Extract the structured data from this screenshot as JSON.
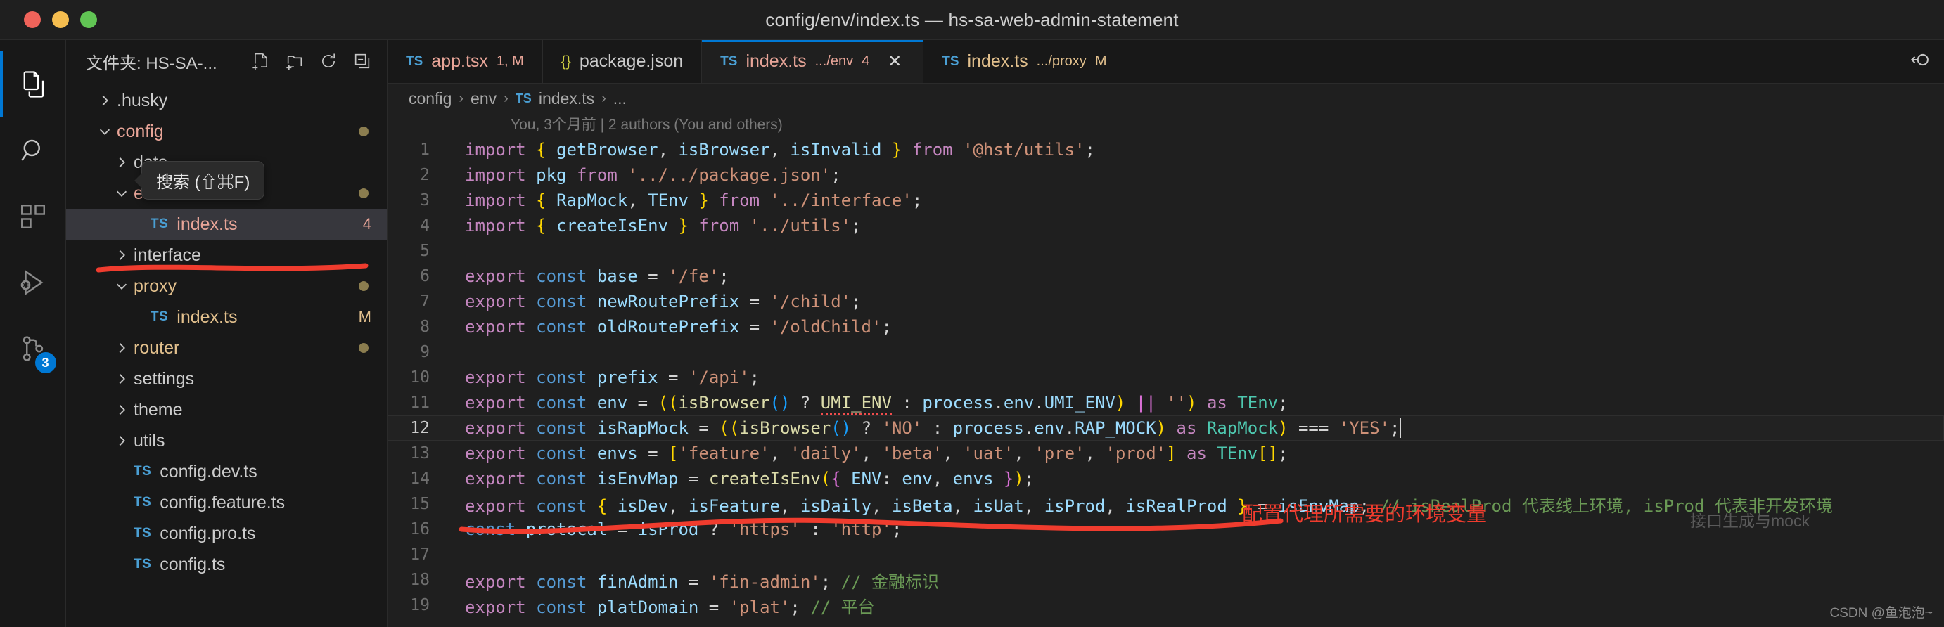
{
  "window": {
    "title": "config/env/index.ts — hs-sa-web-admin-statement",
    "traffic_lights": [
      "close",
      "minimize",
      "zoom"
    ]
  },
  "activitybar": {
    "items": [
      {
        "name": "explorer",
        "icon": "files-icon",
        "active": true,
        "badge": ""
      },
      {
        "name": "search",
        "icon": "search-icon",
        "active": false,
        "badge": ""
      },
      {
        "name": "extensions",
        "icon": "extensions-icon",
        "active": false,
        "badge": ""
      },
      {
        "name": "run-and-debug",
        "icon": "run-debug-icon",
        "active": false,
        "badge": ""
      },
      {
        "name": "source-control",
        "icon": "source-control-icon",
        "active": false,
        "badge": "3"
      }
    ]
  },
  "tooltip": {
    "text": "搜索 (⇧⌘F)"
  },
  "explorer": {
    "title": "文件夹: HS-SA-...",
    "actions": [
      "new-file-icon",
      "new-folder-icon",
      "refresh-icon",
      "collapse-all-icon"
    ],
    "tree": [
      {
        "label": ".husky",
        "kind": "folder",
        "expanded": false,
        "indent": 1,
        "color": "plain",
        "status": "",
        "dot": false,
        "selected": false
      },
      {
        "label": "config",
        "kind": "folder",
        "expanded": true,
        "indent": 1,
        "color": "mod",
        "status": "",
        "dot": true,
        "selected": false
      },
      {
        "label": "data",
        "kind": "folder",
        "expanded": false,
        "indent": 2,
        "color": "plain",
        "status": "",
        "dot": false,
        "selected": false
      },
      {
        "label": "env",
        "kind": "folder",
        "expanded": true,
        "indent": 2,
        "color": "mod",
        "status": "",
        "dot": true,
        "selected": false
      },
      {
        "label": "index.ts",
        "kind": "ts",
        "expanded": null,
        "indent": 3,
        "color": "mod",
        "status": "4",
        "dot": false,
        "selected": true
      },
      {
        "label": "interface",
        "kind": "folder",
        "expanded": false,
        "indent": 2,
        "color": "plain",
        "status": "",
        "dot": false,
        "selected": false
      },
      {
        "label": "proxy",
        "kind": "folder",
        "expanded": true,
        "indent": 2,
        "color": "yellow",
        "status": "",
        "dot": true,
        "selected": false
      },
      {
        "label": "index.ts",
        "kind": "ts",
        "expanded": null,
        "indent": 3,
        "color": "yellow",
        "status": "M",
        "dot": false,
        "selected": false
      },
      {
        "label": "router",
        "kind": "folder",
        "expanded": false,
        "indent": 2,
        "color": "yellow",
        "status": "",
        "dot": true,
        "selected": false
      },
      {
        "label": "settings",
        "kind": "folder",
        "expanded": false,
        "indent": 2,
        "color": "plain",
        "status": "",
        "dot": false,
        "selected": false
      },
      {
        "label": "theme",
        "kind": "folder",
        "expanded": false,
        "indent": 2,
        "color": "plain",
        "status": "",
        "dot": false,
        "selected": false
      },
      {
        "label": "utils",
        "kind": "folder",
        "expanded": false,
        "indent": 2,
        "color": "plain",
        "status": "",
        "dot": false,
        "selected": false
      },
      {
        "label": "config.dev.ts",
        "kind": "ts",
        "expanded": null,
        "indent": 2,
        "color": "plain",
        "status": "",
        "dot": false,
        "selected": false
      },
      {
        "label": "config.feature.ts",
        "kind": "ts",
        "expanded": null,
        "indent": 2,
        "color": "plain",
        "status": "",
        "dot": false,
        "selected": false
      },
      {
        "label": "config.pro.ts",
        "kind": "ts",
        "expanded": null,
        "indent": 2,
        "color": "plain",
        "status": "",
        "dot": false,
        "selected": false
      },
      {
        "label": "config.ts",
        "kind": "ts",
        "expanded": null,
        "indent": 2,
        "color": "plain",
        "status": "",
        "dot": false,
        "selected": false
      }
    ]
  },
  "tabs": [
    {
      "icon": "ts-icon",
      "name": "app.tsx",
      "suffix": "",
      "status": "1, M",
      "active": false,
      "color": "mod",
      "close": false
    },
    {
      "icon": "json-icon",
      "name": "package.json",
      "suffix": "",
      "status": "",
      "active": false,
      "color": "plain",
      "close": false
    },
    {
      "icon": "ts-icon",
      "name": "index.ts",
      "suffix": ".../env",
      "status": "4",
      "active": true,
      "color": "mod",
      "close": true
    },
    {
      "icon": "ts-icon",
      "name": "index.ts",
      "suffix": ".../proxy",
      "status": "M",
      "active": false,
      "color": "yellow",
      "close": false
    }
  ],
  "tabbar_actions": [
    "split-editor-icon"
  ],
  "breadcrumb": {
    "items": [
      "config",
      "env",
      "index.ts",
      "..."
    ],
    "file_icon": "ts-icon",
    "separator": "›"
  },
  "blame": "You, 3个月前 | 2 authors (You and others)",
  "editor": {
    "current_line": 12,
    "ghost_hint": "接口生成与mock",
    "lines": [
      {
        "n": 1,
        "tokens": [
          [
            "t-kw",
            "import "
          ],
          [
            "t-br1",
            "{"
          ],
          [
            "t-plain",
            " "
          ],
          [
            "t-var",
            "getBrowser"
          ],
          [
            "t-plain",
            ", "
          ],
          [
            "t-var",
            "isBrowser"
          ],
          [
            "t-plain",
            ", "
          ],
          [
            "t-var",
            "isInvalid"
          ],
          [
            "t-plain",
            " "
          ],
          [
            "t-br1",
            "}"
          ],
          [
            "t-kw",
            " from "
          ],
          [
            "t-str",
            "'@hst/utils'"
          ],
          [
            "t-plain",
            ";"
          ]
        ]
      },
      {
        "n": 2,
        "tokens": [
          [
            "t-kw",
            "import "
          ],
          [
            "t-var",
            "pkg"
          ],
          [
            "t-kw",
            " from "
          ],
          [
            "t-str",
            "'../../package.json'"
          ],
          [
            "t-plain",
            ";"
          ]
        ]
      },
      {
        "n": 3,
        "tokens": [
          [
            "t-kw",
            "import "
          ],
          [
            "t-br1",
            "{"
          ],
          [
            "t-plain",
            " "
          ],
          [
            "t-var",
            "RapMock"
          ],
          [
            "t-plain",
            ", "
          ],
          [
            "t-var",
            "TEnv"
          ],
          [
            "t-plain",
            " "
          ],
          [
            "t-br1",
            "}"
          ],
          [
            "t-kw",
            " from "
          ],
          [
            "t-str",
            "'../interface'"
          ],
          [
            "t-plain",
            ";"
          ]
        ]
      },
      {
        "n": 4,
        "tokens": [
          [
            "t-kw",
            "import "
          ],
          [
            "t-br1",
            "{"
          ],
          [
            "t-plain",
            " "
          ],
          [
            "t-var",
            "createIsEnv"
          ],
          [
            "t-plain",
            " "
          ],
          [
            "t-br1",
            "}"
          ],
          [
            "t-kw",
            " from "
          ],
          [
            "t-str",
            "'../utils'"
          ],
          [
            "t-plain",
            ";"
          ]
        ]
      },
      {
        "n": 5,
        "tokens": []
      },
      {
        "n": 6,
        "tokens": [
          [
            "t-kw",
            "export "
          ],
          [
            "t-decl",
            "const "
          ],
          [
            "t-var",
            "base"
          ],
          [
            "t-plain",
            " = "
          ],
          [
            "t-str",
            "'/fe'"
          ],
          [
            "t-plain",
            ";"
          ]
        ]
      },
      {
        "n": 7,
        "tokens": [
          [
            "t-kw",
            "export "
          ],
          [
            "t-decl",
            "const "
          ],
          [
            "t-var",
            "newRoutePrefix"
          ],
          [
            "t-plain",
            " = "
          ],
          [
            "t-str",
            "'/child'"
          ],
          [
            "t-plain",
            ";"
          ]
        ]
      },
      {
        "n": 8,
        "tokens": [
          [
            "t-kw",
            "export "
          ],
          [
            "t-decl",
            "const "
          ],
          [
            "t-var",
            "oldRoutePrefix"
          ],
          [
            "t-plain",
            " = "
          ],
          [
            "t-str",
            "'/oldChild'"
          ],
          [
            "t-plain",
            ";"
          ]
        ]
      },
      {
        "n": 9,
        "tokens": []
      },
      {
        "n": 10,
        "tokens": [
          [
            "t-kw",
            "export "
          ],
          [
            "t-decl",
            "const "
          ],
          [
            "t-var",
            "prefix"
          ],
          [
            "t-plain",
            " = "
          ],
          [
            "t-str",
            "'/api'"
          ],
          [
            "t-plain",
            ";"
          ]
        ]
      },
      {
        "n": 11,
        "tokens": [
          [
            "t-kw",
            "export "
          ],
          [
            "t-decl",
            "const "
          ],
          [
            "t-var",
            "env"
          ],
          [
            "t-plain",
            " = "
          ],
          [
            "t-br1",
            "(("
          ],
          [
            "t-fn",
            "isBrowser"
          ],
          [
            "t-br3",
            "()"
          ],
          [
            "t-plain",
            " ? "
          ],
          [
            "t-fn-err",
            "UMI_ENV"
          ],
          [
            "t-plain",
            " : "
          ],
          [
            "t-var",
            "process"
          ],
          [
            "t-plain",
            "."
          ],
          [
            "t-var",
            "env"
          ],
          [
            "t-plain",
            "."
          ],
          [
            "t-var",
            "UMI_ENV"
          ],
          [
            "t-br1",
            ")"
          ],
          [
            "t-br2",
            " || "
          ],
          [
            "t-str",
            "''"
          ],
          [
            "t-br1",
            ")"
          ],
          [
            "t-kw",
            " as "
          ],
          [
            "t-type",
            "TEnv"
          ],
          [
            "t-plain",
            ";"
          ]
        ]
      },
      {
        "n": 12,
        "tokens": [
          [
            "t-kw",
            "export "
          ],
          [
            "t-decl",
            "const "
          ],
          [
            "t-var",
            "isRapMock"
          ],
          [
            "t-plain",
            " = "
          ],
          [
            "t-br1",
            "(("
          ],
          [
            "t-fn",
            "isBrowser"
          ],
          [
            "t-br3",
            "()"
          ],
          [
            "t-plain",
            " ? "
          ],
          [
            "t-str",
            "'NO'"
          ],
          [
            "t-plain",
            " : "
          ],
          [
            "t-var",
            "process"
          ],
          [
            "t-plain",
            "."
          ],
          [
            "t-var",
            "env"
          ],
          [
            "t-plain",
            "."
          ],
          [
            "t-var",
            "RAP_MOCK"
          ],
          [
            "t-br1",
            ")"
          ],
          [
            "t-kw",
            " as "
          ],
          [
            "t-type",
            "RapMock"
          ],
          [
            "t-br1",
            ")"
          ],
          [
            "t-plain",
            " "
          ],
          [
            "t-op",
            "==="
          ],
          [
            "t-plain",
            " "
          ],
          [
            "t-str",
            "'YES'"
          ],
          [
            "t-plain",
            ";"
          ],
          [
            "caret",
            ""
          ]
        ]
      },
      {
        "n": 13,
        "tokens": [
          [
            "t-kw",
            "export "
          ],
          [
            "t-decl",
            "const "
          ],
          [
            "t-var",
            "envs"
          ],
          [
            "t-plain",
            " = "
          ],
          [
            "t-br1",
            "["
          ],
          [
            "t-str",
            "'feature'"
          ],
          [
            "t-plain",
            ", "
          ],
          [
            "t-str",
            "'daily'"
          ],
          [
            "t-plain",
            ", "
          ],
          [
            "t-str",
            "'beta'"
          ],
          [
            "t-plain",
            ", "
          ],
          [
            "t-str",
            "'uat'"
          ],
          [
            "t-plain",
            ", "
          ],
          [
            "t-str",
            "'pre'"
          ],
          [
            "t-plain",
            ", "
          ],
          [
            "t-str",
            "'prod'"
          ],
          [
            "t-br1",
            "]"
          ],
          [
            "t-kw",
            " as "
          ],
          [
            "t-type",
            "TEnv"
          ],
          [
            "t-br1",
            "[]"
          ],
          [
            "t-plain",
            ";"
          ]
        ]
      },
      {
        "n": 14,
        "tokens": [
          [
            "t-kw",
            "export "
          ],
          [
            "t-decl",
            "const "
          ],
          [
            "t-var",
            "isEnvMap"
          ],
          [
            "t-plain",
            " = "
          ],
          [
            "t-fn",
            "createIsEnv"
          ],
          [
            "t-br1",
            "("
          ],
          [
            "t-br2",
            "{"
          ],
          [
            "t-plain",
            " "
          ],
          [
            "t-var",
            "ENV"
          ],
          [
            "t-plain",
            ": "
          ],
          [
            "t-var",
            "env"
          ],
          [
            "t-plain",
            ", "
          ],
          [
            "t-var",
            "envs"
          ],
          [
            "t-plain",
            " "
          ],
          [
            "t-br2",
            "}"
          ],
          [
            "t-br1",
            ")"
          ],
          [
            "t-plain",
            ";"
          ]
        ]
      },
      {
        "n": 15,
        "tokens": [
          [
            "t-kw",
            "export "
          ],
          [
            "t-decl",
            "const "
          ],
          [
            "t-br1",
            "{"
          ],
          [
            "t-plain",
            " "
          ],
          [
            "t-var",
            "isDev"
          ],
          [
            "t-plain",
            ", "
          ],
          [
            "t-var",
            "isFeature"
          ],
          [
            "t-plain",
            ", "
          ],
          [
            "t-var",
            "isDaily"
          ],
          [
            "t-plain",
            ", "
          ],
          [
            "t-var",
            "isBeta"
          ],
          [
            "t-plain",
            ", "
          ],
          [
            "t-var",
            "isUat"
          ],
          [
            "t-plain",
            ", "
          ],
          [
            "t-var",
            "isProd"
          ],
          [
            "t-plain",
            ", "
          ],
          [
            "t-var",
            "isRealProd"
          ],
          [
            "t-plain",
            " "
          ],
          [
            "t-br1",
            "}"
          ],
          [
            "t-plain",
            " = "
          ],
          [
            "t-var",
            "isEnvMap"
          ],
          [
            "t-plain",
            "; "
          ],
          [
            "t-cmt",
            "// isRealProd 代表线上环境, isProd 代表非开发环境"
          ]
        ]
      },
      {
        "n": 16,
        "tokens": [
          [
            "t-decl",
            "const "
          ],
          [
            "t-var",
            "protocal"
          ],
          [
            "t-plain",
            " = "
          ],
          [
            "t-var",
            "isProd"
          ],
          [
            "t-plain",
            " ? "
          ],
          [
            "t-str",
            "'https'"
          ],
          [
            "t-plain",
            " : "
          ],
          [
            "t-str",
            "'http'"
          ],
          [
            "t-plain",
            ";"
          ]
        ]
      },
      {
        "n": 17,
        "tokens": []
      },
      {
        "n": 18,
        "tokens": [
          [
            "t-kw",
            "export "
          ],
          [
            "t-decl",
            "const "
          ],
          [
            "t-var",
            "finAdmin"
          ],
          [
            "t-plain",
            " = "
          ],
          [
            "t-str",
            "'fin-admin'"
          ],
          [
            "t-plain",
            "; "
          ],
          [
            "t-cmt",
            "// 金融标识"
          ]
        ]
      },
      {
        "n": 19,
        "tokens": [
          [
            "t-kw",
            "export "
          ],
          [
            "t-decl",
            "const "
          ],
          [
            "t-var",
            "platDomain"
          ],
          [
            "t-plain",
            " = "
          ],
          [
            "t-str",
            "'plat'"
          ],
          [
            "t-plain",
            "; "
          ],
          [
            "t-cmt",
            "// 平台"
          ]
        ]
      }
    ]
  },
  "annotations": {
    "note": "配置代理所需要的环境变量",
    "color": "#f03c2e"
  },
  "watermark": "CSDN @鱼泡泡~"
}
